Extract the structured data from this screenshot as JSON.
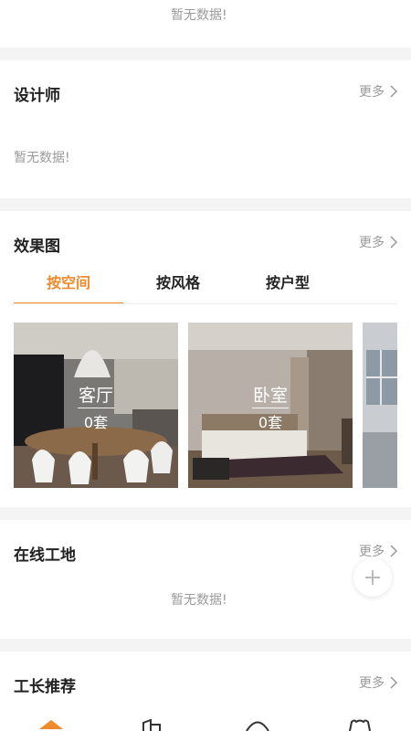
{
  "top_section": {
    "empty_text": "暂无数据!"
  },
  "designers": {
    "title": "设计师",
    "more": "更多",
    "empty_text": "暂无数据!"
  },
  "renderings": {
    "title": "效果图",
    "more": "更多",
    "tabs": [
      {
        "label": "按空间",
        "active": true
      },
      {
        "label": "按风格",
        "active": false
      },
      {
        "label": "按户型",
        "active": false
      }
    ],
    "cards": [
      {
        "name": "客厅",
        "count": "0套"
      },
      {
        "name": "卧室",
        "count": "0套"
      }
    ]
  },
  "sites": {
    "title": "在线工地",
    "more": "更多",
    "empty_text": "暂无数据!"
  },
  "foremen": {
    "title": "工长推荐",
    "more": "更多"
  },
  "colors": {
    "accent": "#f08a2c",
    "muted": "#999999",
    "background": "#f4f4f4"
  },
  "icons": {
    "more_arrow": "chevron-right-icon",
    "fab": "plus-icon"
  }
}
